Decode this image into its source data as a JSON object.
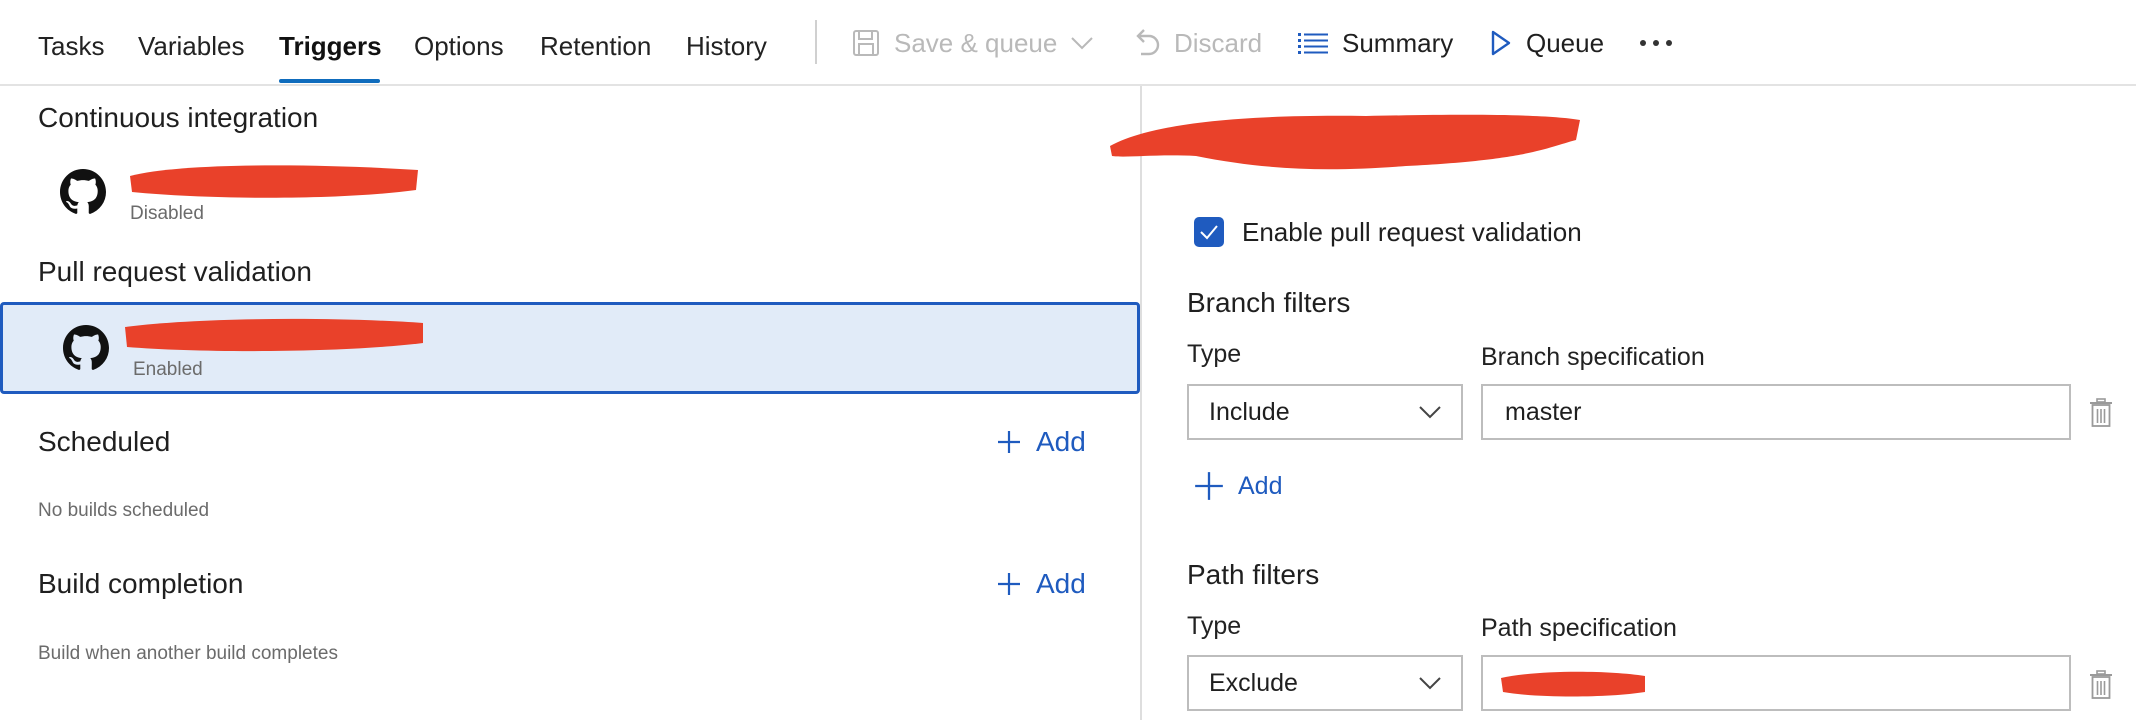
{
  "toolbar": {
    "tabs": [
      {
        "label": "Tasks"
      },
      {
        "label": "Variables"
      },
      {
        "label": "Triggers",
        "active": true
      },
      {
        "label": "Options"
      },
      {
        "label": "Retention"
      },
      {
        "label": "History"
      }
    ],
    "save_queue_label": "Save & queue",
    "discard_label": "Discard",
    "summary_label": "Summary",
    "queue_label": "Queue",
    "more_label": "···"
  },
  "left": {
    "ci_title": "Continuous integration",
    "ci_status": "Disabled",
    "pr_title": "Pull request validation",
    "pr_status": "Enabled",
    "scheduled_title": "Scheduled",
    "scheduled_add": "Add",
    "scheduled_hint": "No builds scheduled",
    "completion_title": "Build completion",
    "completion_add": "Add",
    "completion_hint": "Build when another build completes"
  },
  "right": {
    "enable_pr_label": "Enable pull request validation",
    "enable_pr_checked": true,
    "branch_filters_title": "Branch filters",
    "branch_type_label": "Type",
    "branch_spec_label": "Branch specification",
    "branch_type_value": "Include",
    "branch_spec_value": "master",
    "branch_add": "Add",
    "path_filters_title": "Path filters",
    "path_type_label": "Type",
    "path_spec_label": "Path specification",
    "path_type_value": "Exclude"
  },
  "colors": {
    "accent": "#1f5bbf",
    "selected_row_bg": "#e1ebf8",
    "redaction": "#e9412a",
    "disabled_text": "#b9b9b9"
  },
  "icons": [
    "save-icon",
    "chevron-down-icon",
    "undo-icon",
    "list-icon",
    "play-icon",
    "more-icon",
    "github-icon",
    "plus-icon",
    "check-icon",
    "trash-icon"
  ]
}
